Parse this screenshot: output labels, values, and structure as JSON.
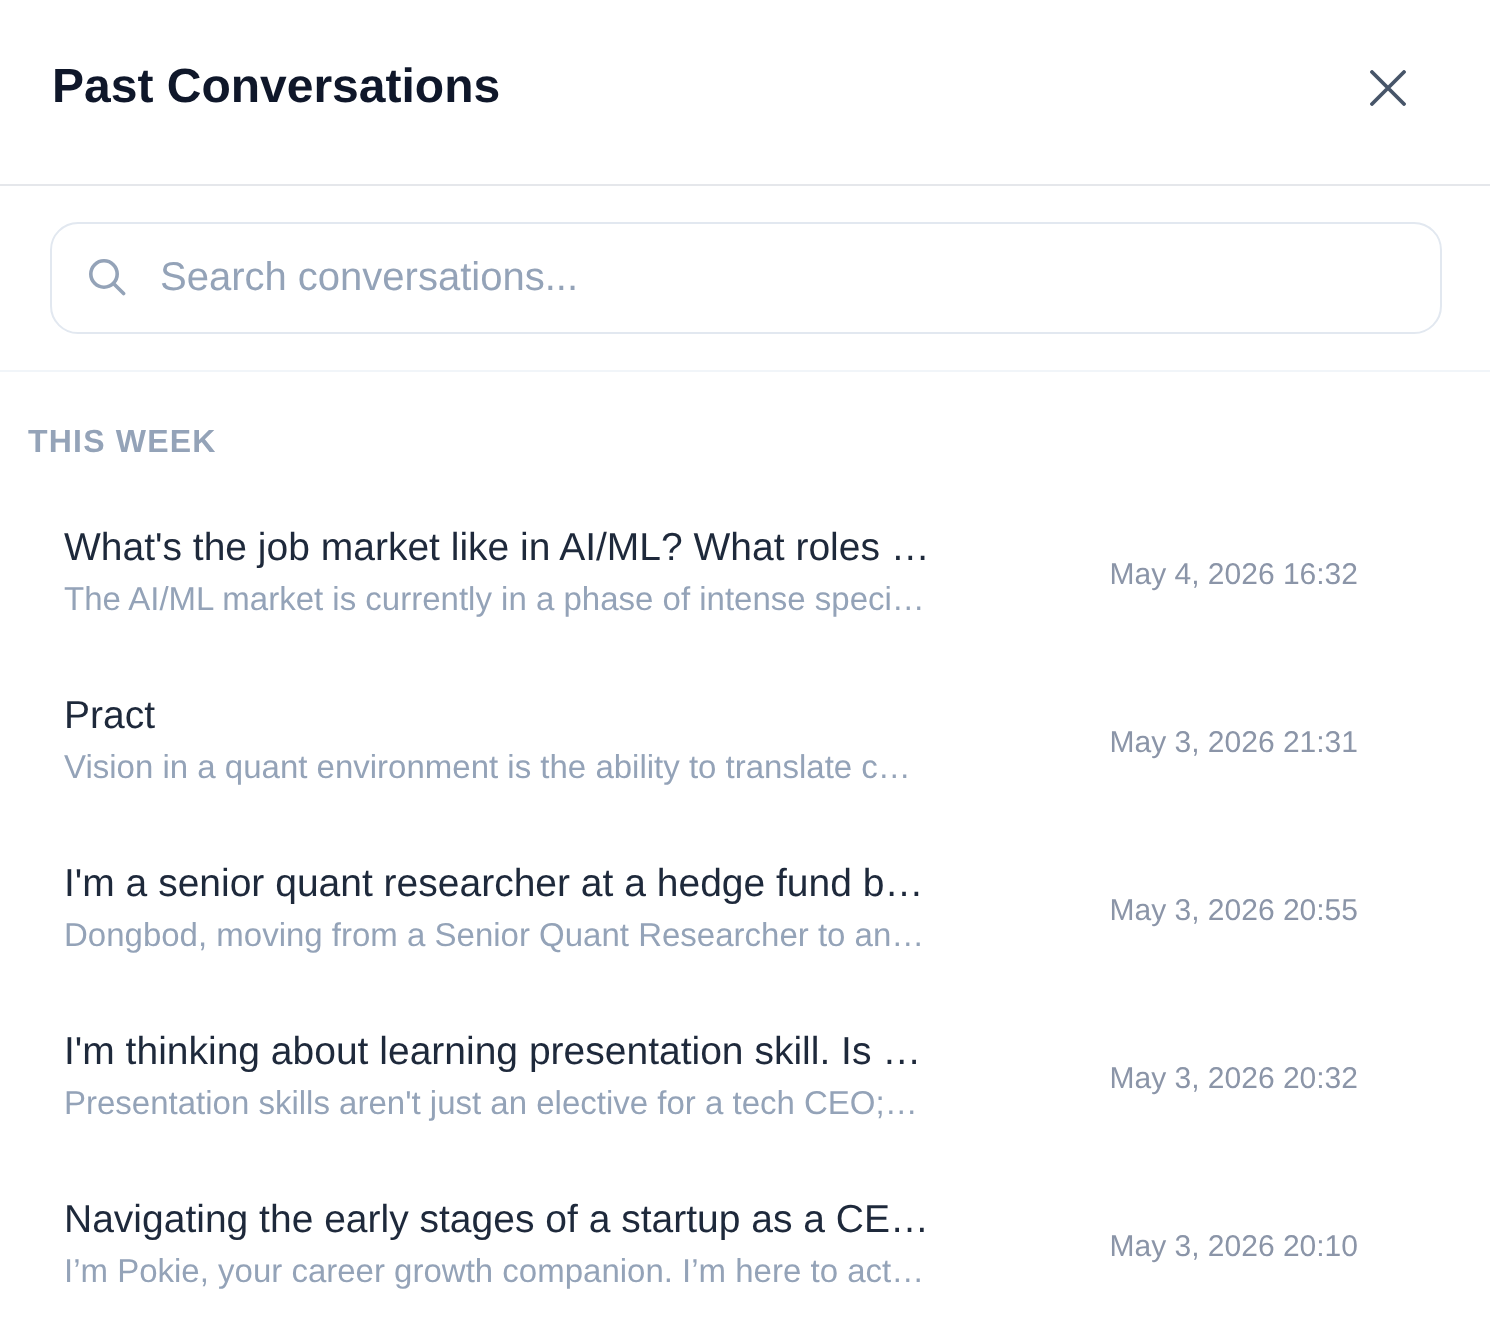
{
  "header": {
    "title": "Past Conversations"
  },
  "search": {
    "placeholder": "Search conversations..."
  },
  "sections": [
    {
      "heading": "THIS WEEK",
      "conversations": [
        {
          "title": "What's the job market like in AI/ML? What roles …",
          "preview": "The AI/ML market is currently in a phase of intense speci…",
          "date": "May 4, 2026 16:32"
        },
        {
          "title": "Pract",
          "preview": "Vision in a quant environment is the ability to translate c…",
          "date": "May 3, 2026 21:31"
        },
        {
          "title": "I'm a senior quant researcher at a hedge fund b…",
          "preview": "Dongbod, moving from a Senior Quant Researcher to an…",
          "date": "May 3, 2026 20:55"
        },
        {
          "title": "I'm thinking about learning presentation skill. Is …",
          "preview": "Presentation skills aren't just an elective for a tech CEO;…",
          "date": "May 3, 2026 20:32"
        },
        {
          "title": "Navigating the early stages of a startup as a CE…",
          "preview": "I’m Pokie, your career growth companion. I’m here to act…",
          "date": "May 3, 2026 20:10"
        }
      ]
    }
  ]
}
